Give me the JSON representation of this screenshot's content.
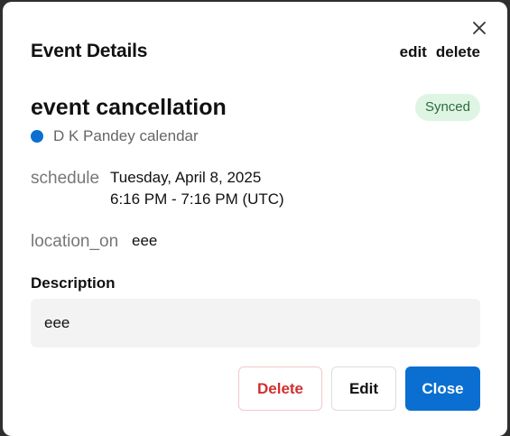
{
  "dialog": {
    "title": "Event Details",
    "header_edit_label": "edit",
    "header_delete_label": "delete",
    "close_icon": "close-icon"
  },
  "event": {
    "title": "event cancellation",
    "sync_status": "Synced",
    "calendar_name": "D K Pandey calendar",
    "calendar_color": "#0a6fd0"
  },
  "schedule": {
    "label": "schedule",
    "date": "Tuesday, April 8, 2025",
    "time": "6:16 PM - 7:16 PM (UTC)"
  },
  "location": {
    "label": "location_on",
    "value": "eee"
  },
  "description": {
    "title": "Description",
    "value": "eee"
  },
  "footer": {
    "delete_label": "Delete",
    "edit_label": "Edit",
    "close_label": "Close"
  },
  "colors": {
    "primary": "#0a6fd0",
    "danger": "#d12f2f",
    "synced_bg": "#dff5e3",
    "synced_text": "#2c6b3b"
  }
}
